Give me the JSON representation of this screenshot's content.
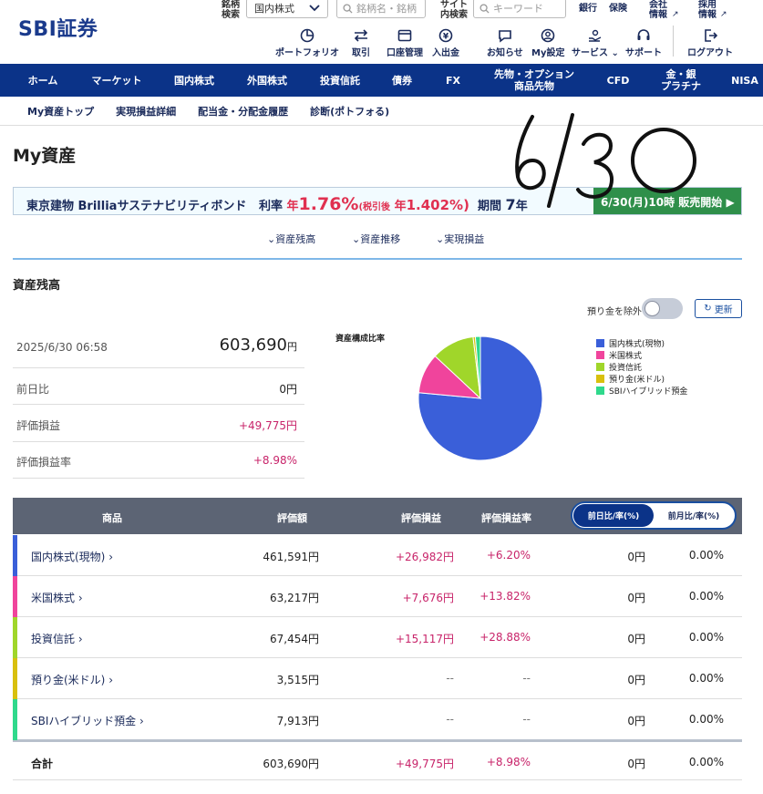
{
  "header": {
    "logo": "SBI証券",
    "stock_search_label": "銘柄\n検索",
    "stock_search_select": "国内株式",
    "stock_search_placeholder": "銘柄名・銘柄",
    "site_search_label": "サイト\n内検索",
    "site_search_placeholder": "キーワード",
    "links": [
      "銀行",
      "保険",
      "会社\n情報",
      "採用\n情報"
    ],
    "icons": [
      {
        "label": "ポートフォリオ",
        "icon": "portfolio-icon"
      },
      {
        "label": "取引",
        "icon": "trade-icon"
      },
      {
        "label": "口座管理",
        "icon": "account-icon"
      },
      {
        "label": "入出金",
        "icon": "deposit-icon"
      },
      {
        "label": "お知らせ",
        "icon": "notice-icon"
      },
      {
        "label": "My設定",
        "icon": "user-icon"
      },
      {
        "label": "サービス",
        "icon": "service-icon"
      },
      {
        "label": "サポート",
        "icon": "support-icon"
      },
      {
        "label": "ログアウト",
        "icon": "logout-icon"
      }
    ]
  },
  "nav": [
    "ホーム",
    "マーケット",
    "国内株式",
    "外国株式",
    "投資信託",
    "債券",
    "FX",
    "先物・オプション\n商品先物",
    "CFD",
    "金・銀\nプラチナ",
    "NISA"
  ],
  "subnav": [
    "My資産トップ",
    "実現損益詳細",
    "配当金・分配金履歴",
    "診断(ポトフォる)"
  ],
  "page_title": "My資産",
  "banner": {
    "name": "東京建物 Brilliaサステナビリティボンド",
    "rate_label": "利率",
    "rate_prefix": "年",
    "rate": "1.76%",
    "after_tax_label": "(税引後",
    "after_tax_prefix": "年",
    "after_tax": "1.402%)",
    "period_label": "期間",
    "period": "7",
    "period_unit": "年",
    "sale": "6/30(月)10時 販売開始 ▶"
  },
  "anchors": [
    "資産残高",
    "資産推移",
    "実現損益"
  ],
  "section_title": "資産残高",
  "toggle_label": "預り金を除外",
  "refresh_label": "更新",
  "summary": {
    "datetime": "2025/6/30 06:58",
    "total": "603,690",
    "total_unit": "円",
    "rows": [
      {
        "label": "前日比",
        "value": "0円"
      },
      {
        "label": "評価損益",
        "value": "+49,775円"
      },
      {
        "label": "評価損益率",
        "value": "+8.98%"
      }
    ]
  },
  "chart_data": {
    "type": "pie",
    "title": "資産構成比率",
    "series": [
      {
        "name": "国内株式(現物)",
        "value": 461591,
        "color": "#3a5fd9"
      },
      {
        "name": "米国株式",
        "value": 63217,
        "color": "#f0449c"
      },
      {
        "name": "投資信託",
        "value": 67454,
        "color": "#a0d62a"
      },
      {
        "name": "預り金(米ドル)",
        "value": 3515,
        "color": "#d9c00d"
      },
      {
        "name": "SBIハイブリッド預金",
        "value": 7913,
        "color": "#2fd98c"
      }
    ]
  },
  "table": {
    "headers": [
      "商品",
      "評価額",
      "評価損益",
      "評価損益率"
    ],
    "seg_on": "前日比/率(%)",
    "seg_off": "前月比/率(%)",
    "rows": [
      {
        "name": "国内株式(現物)",
        "amount": "461,591円",
        "pl": "+26,982円",
        "plr": "+6.20%",
        "d": "0円",
        "dr": "0.00%",
        "color": "#3a5fd9"
      },
      {
        "name": "米国株式",
        "amount": "63,217円",
        "pl": "+7,676円",
        "plr": "+13.82%",
        "d": "0円",
        "dr": "0.00%",
        "color": "#f0449c"
      },
      {
        "name": "投資信託",
        "amount": "67,454円",
        "pl": "+15,117円",
        "plr": "+28.88%",
        "d": "0円",
        "dr": "0.00%",
        "color": "#a0d62a"
      },
      {
        "name": "預り金(米ドル)",
        "amount": "3,515円",
        "pl": "--",
        "plr": "--",
        "d": "0円",
        "dr": "0.00%",
        "color": "#d9c00d"
      },
      {
        "name": "SBIハイブリッド預金",
        "amount": "7,913円",
        "pl": "--",
        "plr": "--",
        "d": "0円",
        "dr": "0.00%",
        "color": "#2fd98c"
      }
    ],
    "total": {
      "name": "合計",
      "amount": "603,690円",
      "pl": "+49,775円",
      "plr": "+8.98%",
      "d": "0円",
      "dr": "0.00%"
    }
  },
  "handwriting": "6/30"
}
